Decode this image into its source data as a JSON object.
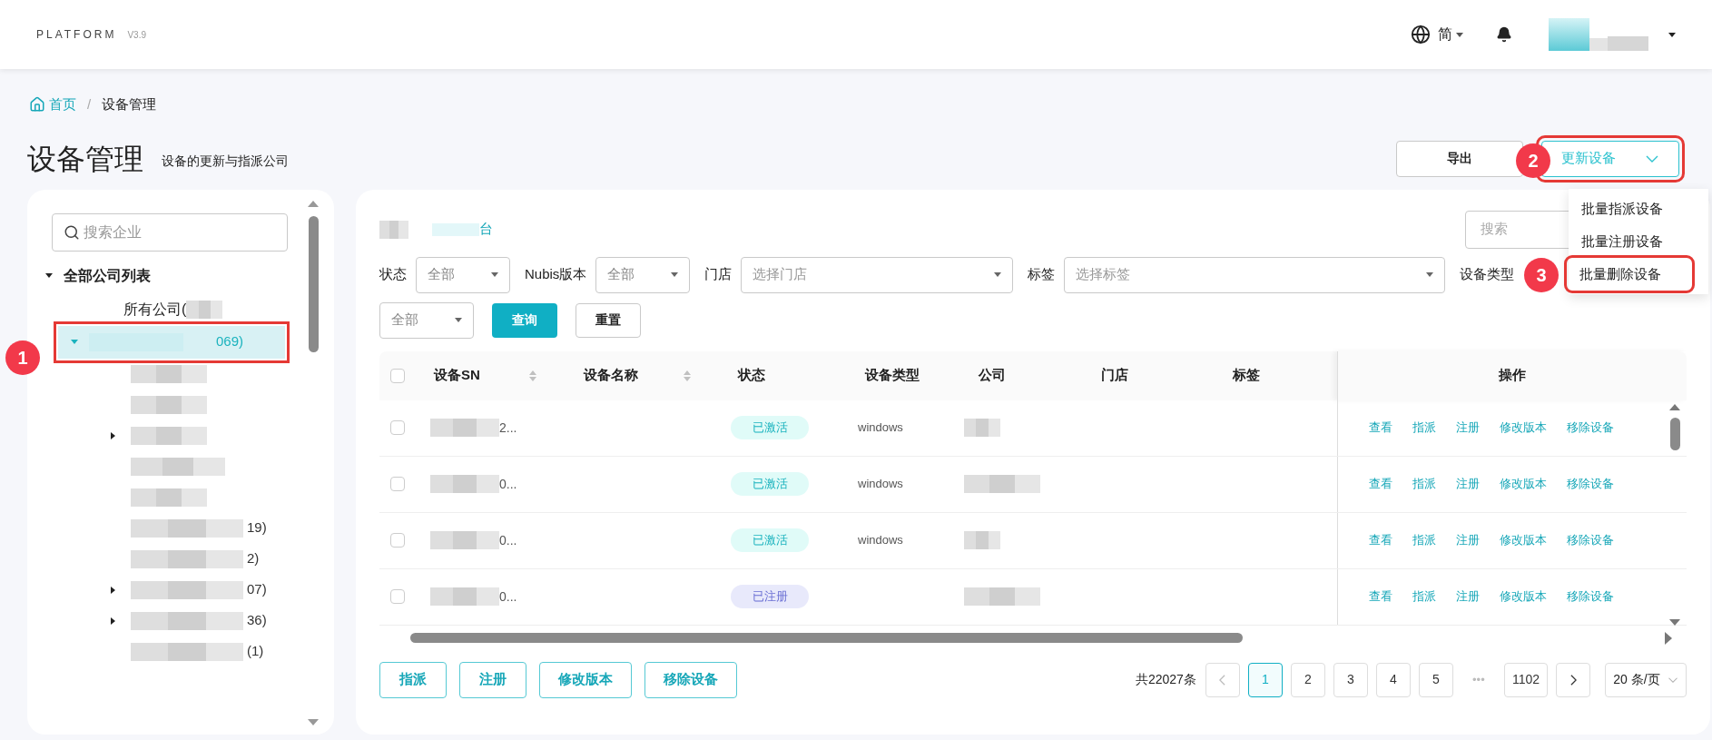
{
  "header": {
    "brand": "PLATFORM",
    "version": "V3.9",
    "language": "简"
  },
  "breadcrumb": {
    "items": [
      "首页",
      "设备管理"
    ],
    "separator": "/"
  },
  "page": {
    "title": "设备管理",
    "subtitle": "设备的更新与指派公司"
  },
  "actions": {
    "export": "导出",
    "update": "更新设备",
    "menu": [
      {
        "label": "批量指派设备",
        "highlighted": false
      },
      {
        "label": "批量注册设备",
        "highlighted": false
      },
      {
        "label": "批量删除设备",
        "highlighted": true
      }
    ]
  },
  "tree": {
    "search_placeholder": "搜索企业",
    "root": {
      "label": "全部公司列表",
      "expanded": true,
      "children": [
        {
          "label": "所有公司(",
          "selected": false,
          "kind": "leaf"
        },
        {
          "label": "069)",
          "selected": true,
          "kind": "branch",
          "expanded": true,
          "children": [
            {
              "kind": "leaf"
            },
            {
              "kind": "leaf"
            },
            {
              "kind": "branch",
              "expanded": false
            },
            {
              "kind": "leaf"
            },
            {
              "kind": "leaf"
            },
            {
              "label": "19)",
              "kind": "leaf"
            },
            {
              "label": "2)",
              "kind": "leaf"
            },
            {
              "label": "07)",
              "kind": "branch",
              "expanded": false
            },
            {
              "label": "36)",
              "kind": "branch",
              "expanded": false
            },
            {
              "label": "(1)",
              "kind": "leaf"
            }
          ]
        }
      ]
    }
  },
  "panel": {
    "crumb": "台",
    "search_placeholder": "搜索"
  },
  "filters": [
    {
      "label": "状态",
      "value": "全部"
    },
    {
      "label": "Nubis版本",
      "value": "全部"
    },
    {
      "label": "门店",
      "placeholder": "选择门店"
    },
    {
      "label": "标签",
      "placeholder": "选择标签"
    },
    {
      "label": "设备类型"
    },
    {
      "value": "全部"
    }
  ],
  "filter_buttons": [
    {
      "label": "查询",
      "kind": "primary"
    },
    {
      "label": "重置",
      "kind": "default"
    }
  ],
  "table": {
    "all_checked": false,
    "columns": [
      {
        "label": "设备SN",
        "sortable": true
      },
      {
        "label": "设备名称",
        "sortable": true
      },
      {
        "label": "状态",
        "sortable": false
      },
      {
        "label": "设备类型",
        "sortable": false
      },
      {
        "label": "公司",
        "sortable": false
      },
      {
        "label": "门店",
        "sortable": false
      },
      {
        "label": "标签",
        "sortable": false
      },
      {
        "label": "操作",
        "sortable": false
      }
    ],
    "rows": [
      {
        "checked": false,
        "sn": "2...",
        "status": {
          "label": "已激活",
          "kind": "activated"
        },
        "type": "windows",
        "actions": [
          "查看",
          "指派",
          "注册",
          "修改版本",
          "移除设备"
        ]
      },
      {
        "checked": false,
        "sn": "0...",
        "status": {
          "label": "已激活",
          "kind": "activated"
        },
        "type": "windows",
        "actions": [
          "查看",
          "指派",
          "注册",
          "修改版本",
          "移除设备"
        ]
      },
      {
        "checked": false,
        "sn": "0...",
        "status": {
          "label": "已激活",
          "kind": "activated"
        },
        "type": "windows",
        "actions": [
          "查看",
          "指派",
          "注册",
          "修改版本",
          "移除设备"
        ]
      },
      {
        "checked": false,
        "sn": "0...",
        "status": {
          "label": "已注册",
          "kind": "registered"
        },
        "actions": [
          "查看",
          "指派",
          "注册",
          "修改版本",
          "移除设备"
        ]
      }
    ]
  },
  "bulk_buttons": [
    "指派",
    "注册",
    "修改版本",
    "移除设备"
  ],
  "pagination": {
    "total": "共22027条",
    "pages": [
      {
        "label": "1",
        "selected": true
      },
      {
        "label": "2",
        "selected": false
      },
      {
        "label": "3",
        "selected": false
      },
      {
        "label": "4",
        "selected": false
      },
      {
        "label": "5",
        "selected": false
      },
      {
        "label": "•••",
        "kind": "ellipsis"
      },
      {
        "label": "1102",
        "selected": false
      }
    ],
    "page_size": "20 条/页"
  },
  "annotations": [
    "1",
    "2",
    "3"
  ]
}
